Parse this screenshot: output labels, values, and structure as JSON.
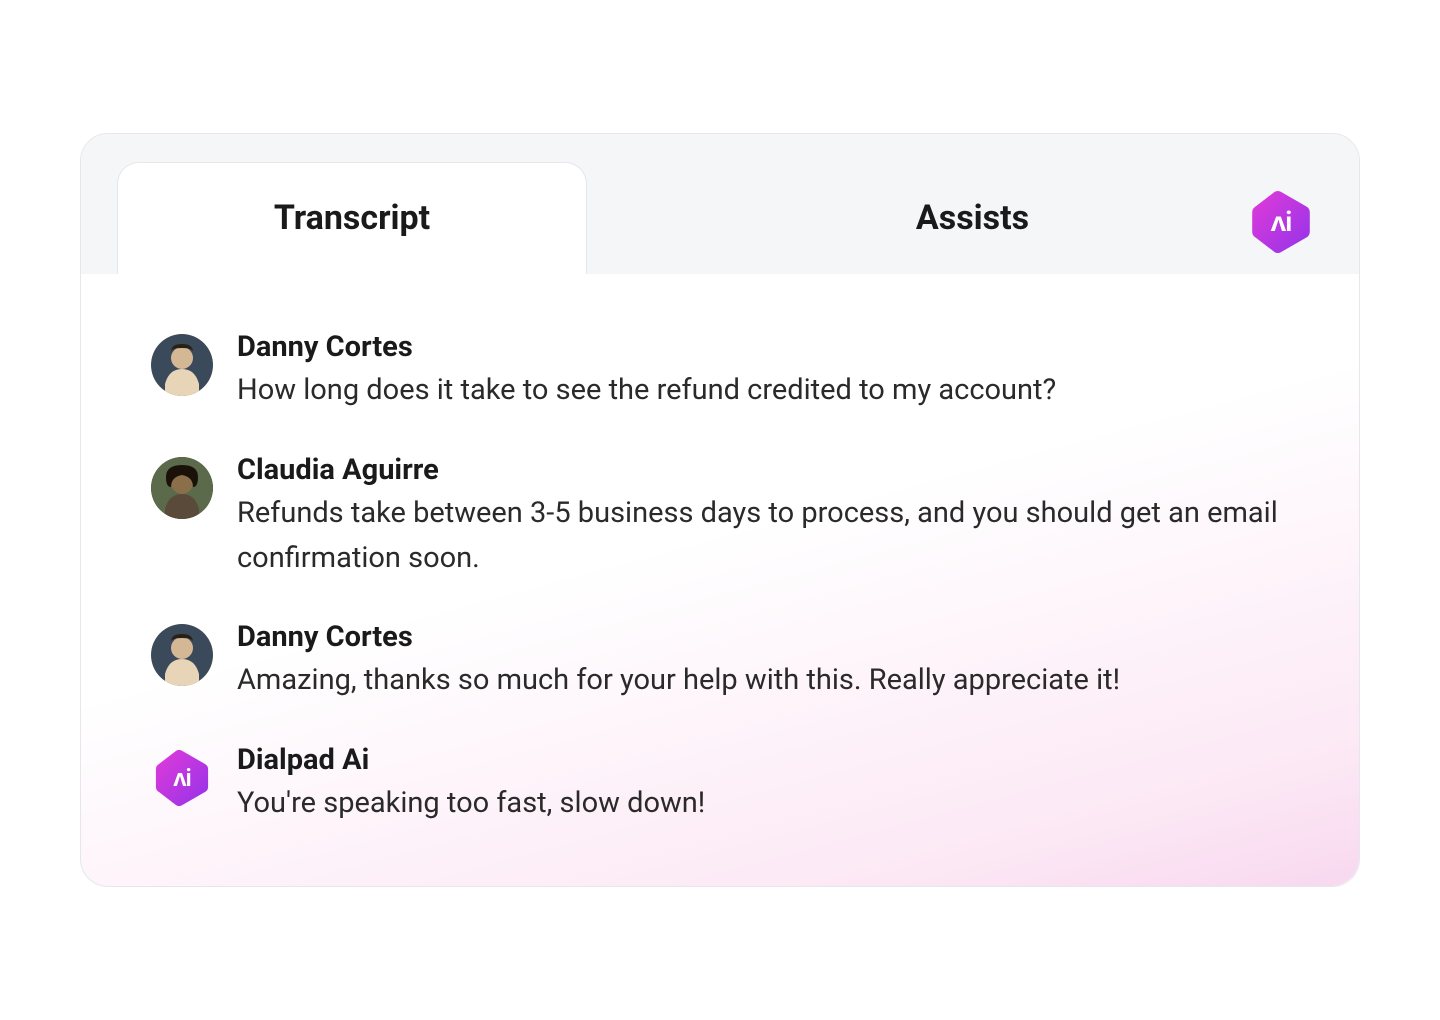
{
  "tabs": {
    "transcript": {
      "label": "Transcript",
      "active": true
    },
    "assists": {
      "label": "Assists",
      "active": false
    }
  },
  "ai_badge": {
    "icon": "ai-icon",
    "gradient_start": "#d946ef",
    "gradient_end": "#a855f7"
  },
  "messages": [
    {
      "name": "Danny Cortes",
      "text": "How long does it take to see the refund credited to my account?",
      "avatar_type": "person",
      "avatar_name": "danny-cortes-avatar"
    },
    {
      "name": "Claudia Aguirre",
      "text": "Refunds take between 3-5 business days to process, and you should get an email confirmation soon.",
      "avatar_type": "person2",
      "avatar_name": "claudia-aguirre-avatar"
    },
    {
      "name": "Danny Cortes",
      "text": "Amazing, thanks so much for your help with this. Really appreciate it!",
      "avatar_type": "person",
      "avatar_name": "danny-cortes-avatar"
    },
    {
      "name": "Dialpad Ai",
      "text": "You're speaking too fast, slow down!",
      "avatar_type": "ai",
      "avatar_name": "dialpad-ai-avatar"
    }
  ]
}
